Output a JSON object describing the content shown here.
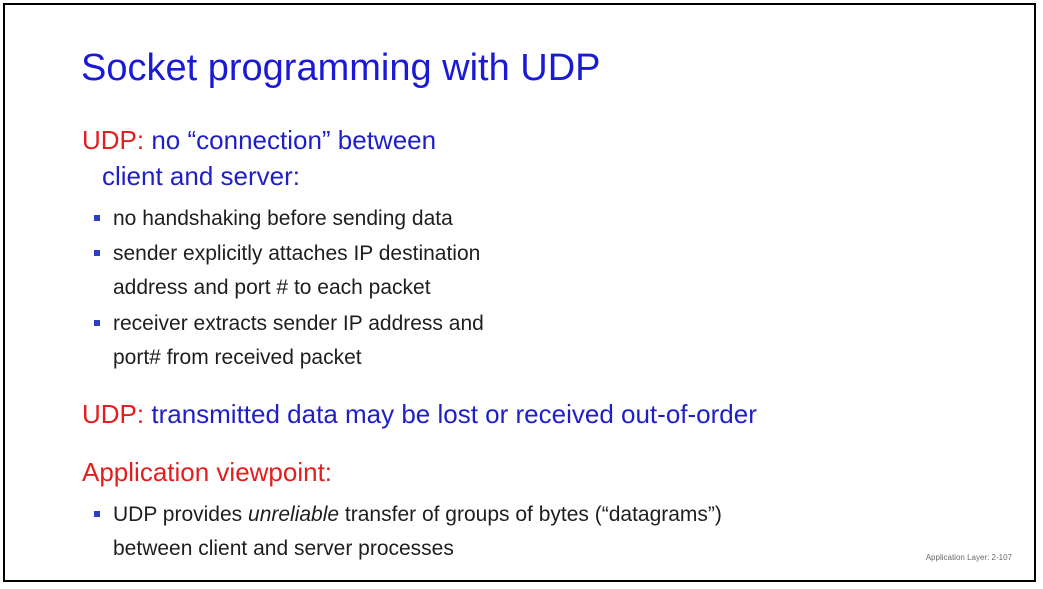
{
  "slide": {
    "title": "Socket programming with UDP",
    "section1": {
      "red_part": "UDP:",
      "blue_part_line1": " no “connection” between",
      "blue_part_line2": "client and server:"
    },
    "bullets1": [
      {
        "line1": "no handshaking before sending data"
      },
      {
        "line1": "sender explicitly attaches IP destination",
        "line2": "address and port # to each packet"
      },
      {
        "line1": "receiver extracts sender IP address and",
        "line2": "port# from received packet"
      }
    ],
    "section2": {
      "red_part": "UDP:",
      "blue_part": " transmitted data may be lost or received out-of-order"
    },
    "section3": {
      "red_part": "Application viewpoint:"
    },
    "bullets2": [
      {
        "pre": "UDP provides ",
        "emph": "unreliable",
        "post": " transfer  of groups of bytes (“datagrams”)",
        "line2": "between client and server processes"
      }
    ],
    "footer": "Application Layer: 2-107"
  }
}
